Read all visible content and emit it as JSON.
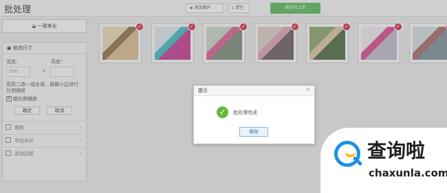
{
  "app": {
    "title": "批处理"
  },
  "toolbar": {
    "add_images": "添加图片",
    "clear": "清空",
    "save_upload": "保存与上传"
  },
  "sidebar": {
    "one_click_beauty": "一键美化",
    "resize": {
      "title": "修改尺寸",
      "width_label": "宽度：",
      "height_label": "高度：",
      "width_value": "500",
      "height_value": "",
      "hint": "宽高二选一或全填，按最小边进行比例缩放",
      "keep_ratio": "按比例缩放",
      "confirm": "确定",
      "cancel": "取消"
    },
    "tools": [
      {
        "label": "裁剪"
      },
      {
        "label": "添加水印"
      },
      {
        "label": "添加边框"
      }
    ]
  },
  "gallery": {
    "photos": [
      {
        "palette": [
          "#e8d8b4",
          "#8f6f4a",
          "#d9b991"
        ]
      },
      {
        "palette": [
          "#d8e3ec",
          "#43b7c0",
          "#c33b92"
        ]
      },
      {
        "palette": [
          "#c4d2c5",
          "#d66290",
          "#7c8b79"
        ]
      },
      {
        "palette": [
          "#d8c9c3",
          "#d9a1b3",
          "#6a5e63"
        ]
      },
      {
        "palette": [
          "#8ca36d",
          "#d8c4a2",
          "#4f6a45"
        ]
      },
      {
        "palette": [
          "#ece8ef",
          "#d64a8e",
          "#bfb6c8"
        ]
      },
      {
        "palette": [
          "#d2d9df",
          "#a56a68",
          "#7f8c97"
        ]
      }
    ]
  },
  "dialog": {
    "title": "提示",
    "message": "批处理完成",
    "button": "保存"
  },
  "watermark": {
    "cn": "查询啦",
    "en": "chaxunla.com"
  }
}
